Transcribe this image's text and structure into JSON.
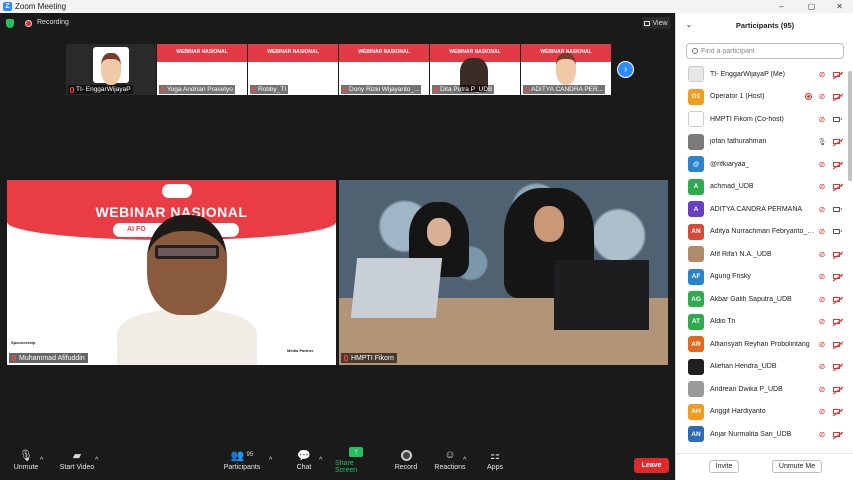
{
  "window": {
    "title": "Zoom Meeting"
  },
  "meeting": {
    "recording_label": "Recording",
    "view_label": "View",
    "thumbnails": [
      {
        "name": "TI- EnggarWijayaP"
      },
      {
        "name": "Yoga Andrian Prasetyo",
        "banner": "WEBINAR NASIONAL"
      },
      {
        "name": "Robby_TI",
        "banner": "WEBINAR NASIONAL"
      },
      {
        "name": "Dony Rizki Wijayanto_...",
        "banner": "WEBINAR NASIONAL"
      },
      {
        "name": "Dita Putra P_UDB",
        "banner": "WEBINAR NASIONAL"
      },
      {
        "name": "ADITYA CANDRA PER...",
        "banner": "WEBINAR NASIONAL"
      }
    ],
    "main_videos": [
      {
        "name": "Muhammad Afifuddin",
        "banner_title": "WEBINAR NASIONAL",
        "pill_text": "AI FO",
        "sponsor": "Sponsorship",
        "media": "Media Partner"
      },
      {
        "name": "HMPTI Fikom"
      }
    ]
  },
  "toolbar": {
    "unmute": "Unmute",
    "start_video": "Start Video",
    "participants": "Participants",
    "participants_count": "95",
    "chat": "Chat",
    "share_screen": "Share Screen",
    "record": "Record",
    "reactions": "Reactions",
    "apps": "Apps",
    "leave": "Leave"
  },
  "participants_panel": {
    "title": "Participants (95)",
    "search_placeholder": "Find a participant",
    "invite": "Invite",
    "unmute_me": "Unmute Me",
    "people": [
      {
        "initials": "",
        "color": "#e8e8e8",
        "name": "TI- EnggarWijayaP (Me)",
        "mic": "off",
        "cam": "off",
        "recording": false
      },
      {
        "initials": "O1",
        "color": "#f29b1d",
        "name": "Operator 1 (Host)",
        "mic": "off",
        "cam": "off",
        "recording": true
      },
      {
        "initials": "",
        "color": "#ffffff",
        "name": "HMPTI Fikom (Co-host)",
        "mic": "off",
        "cam": "on",
        "recording": false
      },
      {
        "initials": "",
        "color": "#7a7a7a",
        "name": "jofan fathurahman",
        "mic": "on",
        "cam": "off",
        "recording": false
      },
      {
        "initials": "@",
        "color": "#2b83c9",
        "name": "@rifkiaryaa_",
        "mic": "off",
        "cam": "off",
        "recording": false
      },
      {
        "initials": "A",
        "color": "#2faa4f",
        "name": "achmad_UDB",
        "mic": "off",
        "cam": "off",
        "recording": false
      },
      {
        "initials": "A",
        "color": "#6a3fc1",
        "name": "ADITYA CANDRA PERMANA",
        "mic": "off",
        "cam": "on",
        "recording": false
      },
      {
        "initials": "AN",
        "color": "#d24b3a",
        "name": "Aditya Nurrachman Febryanto_U...",
        "mic": "off",
        "cam": "on",
        "recording": false
      },
      {
        "initials": "",
        "color": "#b08b6a",
        "name": "Afif Rifa'i N.A._UDB",
        "mic": "off",
        "cam": "off",
        "recording": false
      },
      {
        "initials": "AF",
        "color": "#2b83c9",
        "name": "Agung Frisky",
        "mic": "off",
        "cam": "off",
        "recording": false
      },
      {
        "initials": "AG",
        "color": "#2faa4f",
        "name": "Akbar Galih Saputra_UDB",
        "mic": "off",
        "cam": "off",
        "recording": false
      },
      {
        "initials": "AT",
        "color": "#2faa4f",
        "name": "Aldio Tri",
        "mic": "off",
        "cam": "off",
        "recording": false
      },
      {
        "initials": "AR",
        "color": "#e06a1f",
        "name": "Alfiansyah Reyhan Probolintang",
        "mic": "off",
        "cam": "off",
        "recording": false
      },
      {
        "initials": "",
        "color": "#202020",
        "name": "Aliefian Hendra_UDB",
        "mic": "off",
        "cam": "off",
        "recording": false
      },
      {
        "initials": "",
        "color": "#9a9a9a",
        "name": "Andrean Dwika P_UDB",
        "mic": "off",
        "cam": "off",
        "recording": false
      },
      {
        "initials": "AH",
        "color": "#f29b1d",
        "name": "Anggit Hardiyanto",
        "mic": "off",
        "cam": "off",
        "recording": false
      },
      {
        "initials": "AN",
        "color": "#2b6cb5",
        "name": "Anjar Nurmalita Sari_UDB",
        "mic": "off",
        "cam": "off",
        "recording": false
      }
    ]
  }
}
